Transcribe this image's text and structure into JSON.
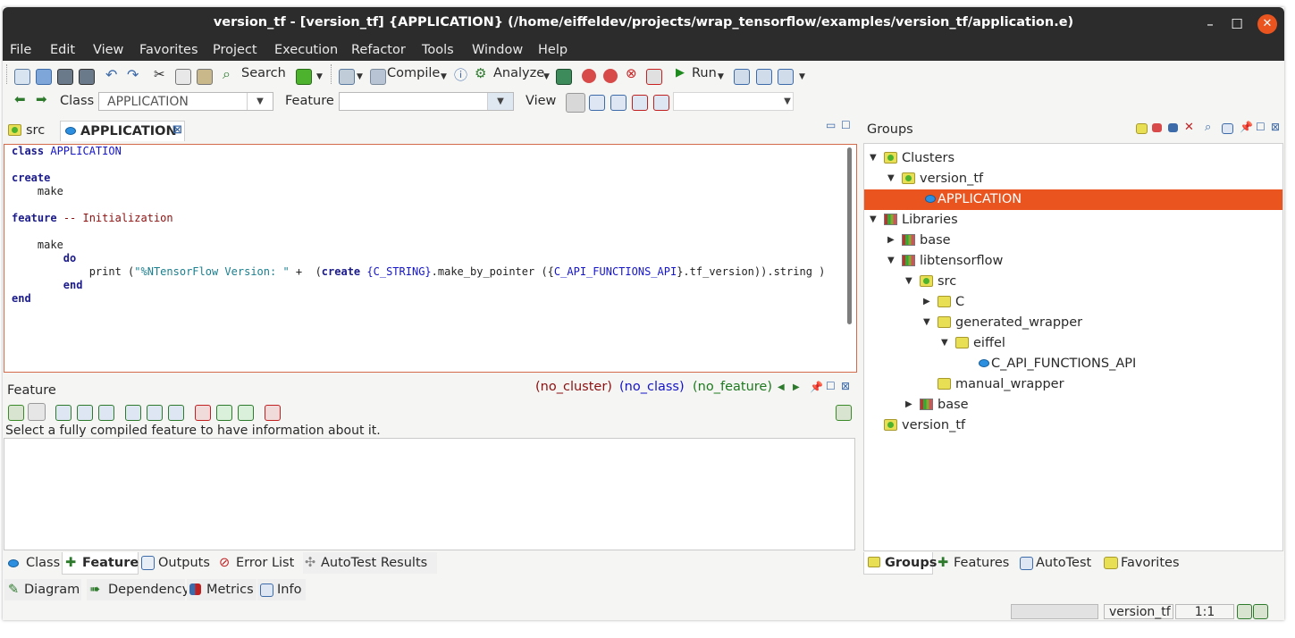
{
  "window": {
    "title": "version_tf - [version_tf] {APPLICATION} (/home/eiffeldev/projects/wrap_tensorflow/examples/version_tf/application.e)",
    "min": "–",
    "max": "☐",
    "close": "✕"
  },
  "menu": [
    "File",
    "Edit",
    "View",
    "Favorites",
    "Project",
    "Execution",
    "Refactor",
    "Tools",
    "Window",
    "Help"
  ],
  "toolbar1": {
    "search": "Search",
    "compile": "Compile",
    "analyze": "Analyze",
    "run": "Run"
  },
  "toolbar2": {
    "class_label": "Class",
    "class_value": "APPLICATION",
    "feature_label": "Feature",
    "feature_value": "",
    "view_label": "View"
  },
  "tabs": {
    "src": "src",
    "application": "APPLICATION"
  },
  "code": {
    "line1_kw": "class",
    "line1_cls": "APPLICATION",
    "create": "create",
    "make": "make",
    "feature": "feature",
    "comment": "-- Initialization",
    "make2": "make",
    "do": "do",
    "print": "print (",
    "string": "\"%NTensorFlow Version: \"",
    "plus": " +  (",
    "create2": "create",
    "cls2": "{C_STRING}",
    "mbp": ".make_by_pointer ({",
    "cls3": "C_API_FUNCTIONS_API",
    "tail": "}.tf_version)).string )",
    "end1": "end",
    "end2": "end"
  },
  "feature_pane": {
    "title": "Feature",
    "no_cluster": "(no_cluster)",
    "no_class": "(no_class)",
    "no_feature": "(no_feature)",
    "info": "Select a fully compiled feature to have information about it."
  },
  "bottom_tabs": [
    "Class",
    "Feature",
    "Outputs",
    "Error List",
    "AutoTest Results"
  ],
  "bottom_tabs2": [
    "Diagram",
    "Dependency",
    "Metrics",
    "Info"
  ],
  "groups": {
    "title": "Groups",
    "tree": [
      {
        "label": "Clusters",
        "level": 0,
        "exp": "open",
        "icon": "folder-g"
      },
      {
        "label": "version_tf",
        "level": 1,
        "exp": "open",
        "icon": "folder-g"
      },
      {
        "label": "APPLICATION",
        "level": 2,
        "exp": "none",
        "icon": "ellipse",
        "selected": true
      },
      {
        "label": "Libraries",
        "level": 0,
        "exp": "open",
        "icon": "lib"
      },
      {
        "label": "base",
        "level": 1,
        "exp": "closed",
        "icon": "lib"
      },
      {
        "label": "libtensorflow",
        "level": 1,
        "exp": "open",
        "icon": "lib"
      },
      {
        "label": "src",
        "level": 2,
        "exp": "open",
        "icon": "folder-g"
      },
      {
        "label": "C",
        "level": 3,
        "exp": "closed",
        "icon": "folder"
      },
      {
        "label": "generated_wrapper",
        "level": 3,
        "exp": "open",
        "icon": "folder"
      },
      {
        "label": "eiffel",
        "level": 4,
        "exp": "open",
        "icon": "folder"
      },
      {
        "label": "C_API_FUNCTIONS_API",
        "level": 5,
        "exp": "none",
        "icon": "ellipse"
      },
      {
        "label": "manual_wrapper",
        "level": 3,
        "exp": "none",
        "icon": "folder"
      },
      {
        "label": "base",
        "level": 2,
        "exp": "closed",
        "icon": "lib"
      },
      {
        "label": "version_tf",
        "level": 0,
        "exp": "none",
        "icon": "folder-g"
      }
    ]
  },
  "right_tabs": [
    "Groups",
    "Features",
    "AutoTest",
    "Favorites"
  ],
  "status": {
    "project": "version_tf",
    "position": "1:1"
  },
  "colors": {
    "accent": "#e9541f",
    "titlebar": "#2c2c2c"
  }
}
